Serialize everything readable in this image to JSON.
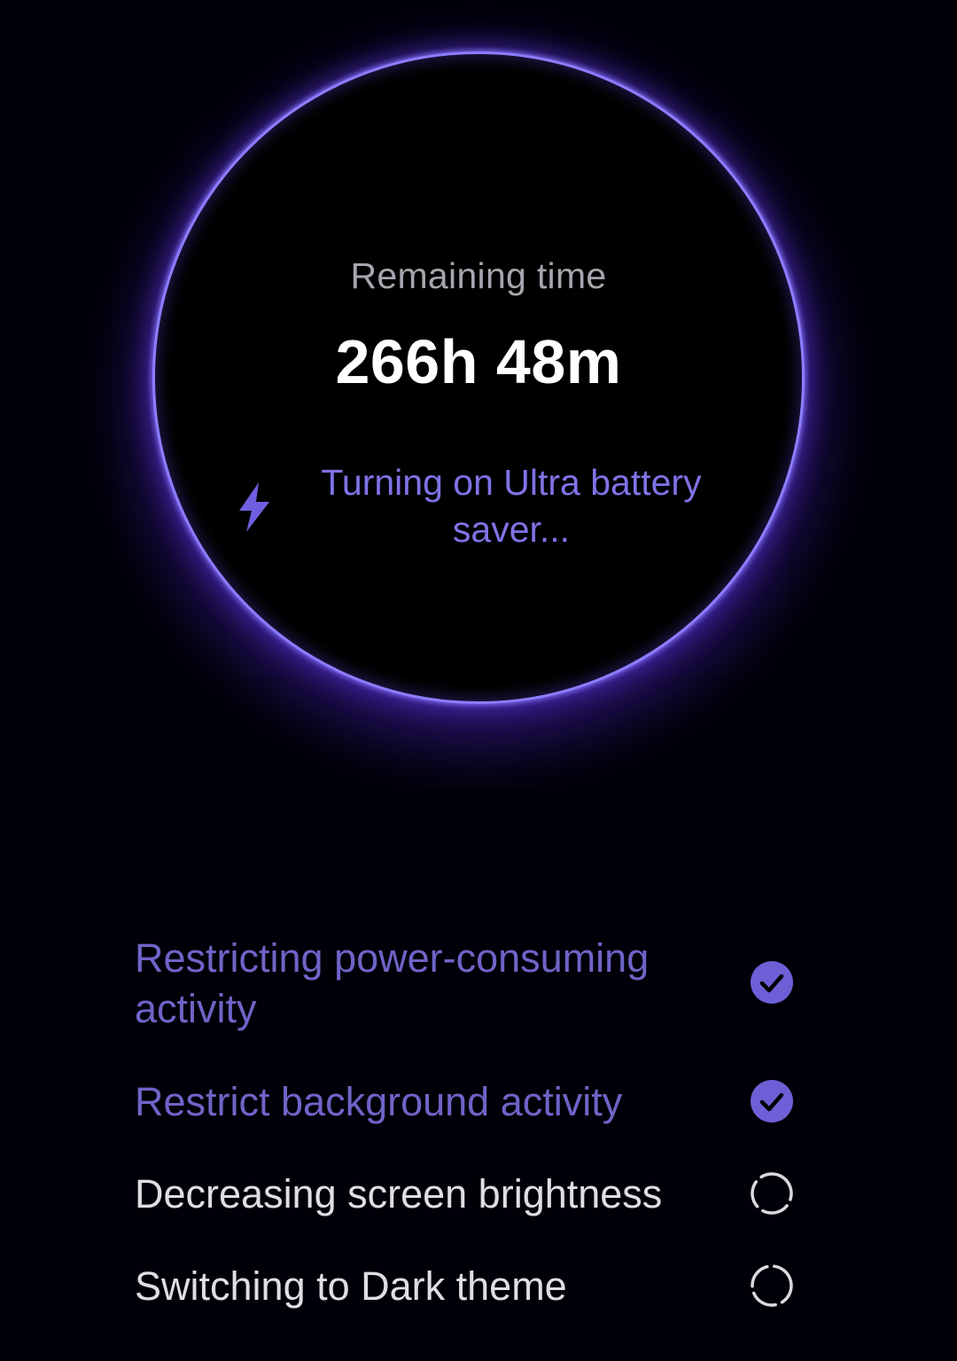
{
  "battery_panel": {
    "remaining_label": "Remaining time",
    "remaining_value": "266h 48m",
    "status_icon": "lightning-bolt-icon",
    "status_text": "Turning on Ultra battery saver..."
  },
  "tasks": [
    {
      "label": "Restricting power-consuming activity",
      "state": "done",
      "icon": "check-circle-icon"
    },
    {
      "label": "Restrict background activity",
      "state": "done",
      "icon": "check-circle-icon"
    },
    {
      "label": "Decreasing screen brightness",
      "state": "in-progress",
      "icon": "loading-spinner-icon"
    },
    {
      "label": "Switching to Dark theme",
      "state": "in-progress",
      "icon": "loading-spinner-icon"
    }
  ],
  "colors": {
    "background": "#000000",
    "ring": "#8d7dff",
    "accent": "#7f73e6",
    "done_text": "#6e64c8",
    "pending_text": "#dedee4",
    "check_fill": "#6d5fd6"
  }
}
